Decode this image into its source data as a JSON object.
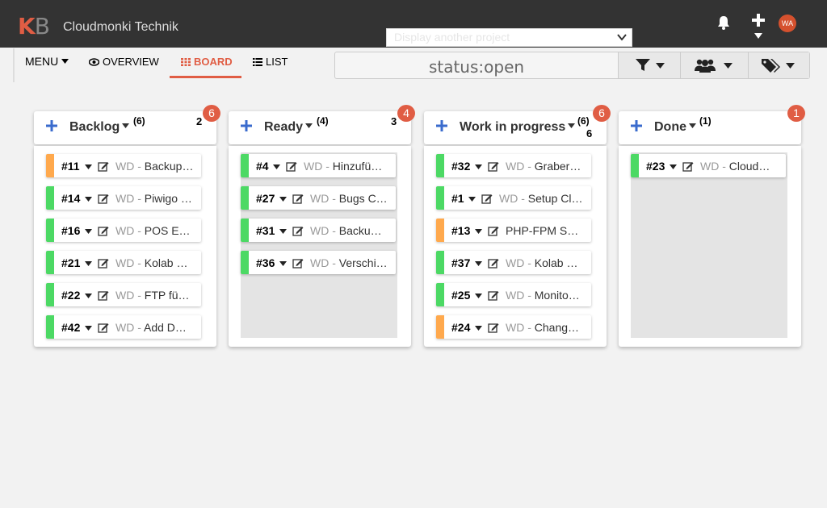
{
  "header": {
    "logo_k": "K",
    "logo_b": "B",
    "project_title": "Cloudmonki Technik",
    "project_select_placeholder": "Display another project",
    "avatar_initials": "WA",
    "icons": [
      "bell-icon",
      "plus-icon",
      "caret-down-icon"
    ]
  },
  "nav": {
    "menu_label": "MENU",
    "overview_label": "OVERVIEW",
    "board_label": "BOARD",
    "list_label": "LIST",
    "active": "BOARD"
  },
  "filter": {
    "query": "status:open",
    "buttons": [
      "filter-icon",
      "users-icon",
      "tags-icon"
    ]
  },
  "colors": {
    "accent": "#e05d44",
    "green": "#4cd964",
    "orange": "#ffa94d",
    "blue": "#3a6bcd",
    "topbar": "#333333"
  },
  "columns": [
    {
      "title": "Backlog",
      "count": "(6)",
      "score": "2",
      "badge": "6",
      "tasks": [
        {
          "id": "#11",
          "prefix": "WD - ",
          "title": "Backup…",
          "color": "orange"
        },
        {
          "id": "#14",
          "prefix": "WD - ",
          "title": "Piwigo …",
          "color": "green"
        },
        {
          "id": "#16",
          "prefix": "WD - ",
          "title": "POS E…",
          "color": "green"
        },
        {
          "id": "#21",
          "prefix": "WD - ",
          "title": "Kolab …",
          "color": "green"
        },
        {
          "id": "#22",
          "prefix": "WD - ",
          "title": "FTP fü…",
          "color": "green"
        },
        {
          "id": "#42",
          "prefix": "WD - ",
          "title": "Add D…",
          "color": "green"
        }
      ]
    },
    {
      "title": "Ready",
      "count": "(4)",
      "score": "3",
      "badge": "4",
      "tasks": [
        {
          "id": "#4",
          "prefix": "WD - ",
          "title": "Hinzufü…",
          "color": "green"
        },
        {
          "id": "#27",
          "prefix": "WD - ",
          "title": "Bugs C…",
          "color": "green"
        },
        {
          "id": "#31",
          "prefix": "WD - ",
          "title": "Backu…",
          "color": "green"
        },
        {
          "id": "#36",
          "prefix": "WD - ",
          "title": "Verschi…",
          "color": "green"
        }
      ]
    },
    {
      "title": "Work in progress",
      "count": "(6)",
      "score": "6",
      "badge": "6",
      "tasks": [
        {
          "id": "#32",
          "prefix": "WD - ",
          "title": "Graber…",
          "color": "green"
        },
        {
          "id": "#1",
          "prefix": "WD - ",
          "title": "Setup Cl…",
          "color": "green"
        },
        {
          "id": "#13",
          "prefix": "",
          "title": "PHP-FPM S…",
          "color": "orange"
        },
        {
          "id": "#37",
          "prefix": "WD - ",
          "title": "Kolab …",
          "color": "green"
        },
        {
          "id": "#25",
          "prefix": "WD - ",
          "title": "Monito…",
          "color": "green"
        },
        {
          "id": "#24",
          "prefix": "WD - ",
          "title": "Chang…",
          "color": "orange"
        }
      ]
    },
    {
      "title": "Done",
      "count": "(1)",
      "score": "",
      "badge": "1",
      "tasks": [
        {
          "id": "#23",
          "prefix": "WD - ",
          "title": "Cloud…",
          "color": "green"
        }
      ]
    }
  ]
}
